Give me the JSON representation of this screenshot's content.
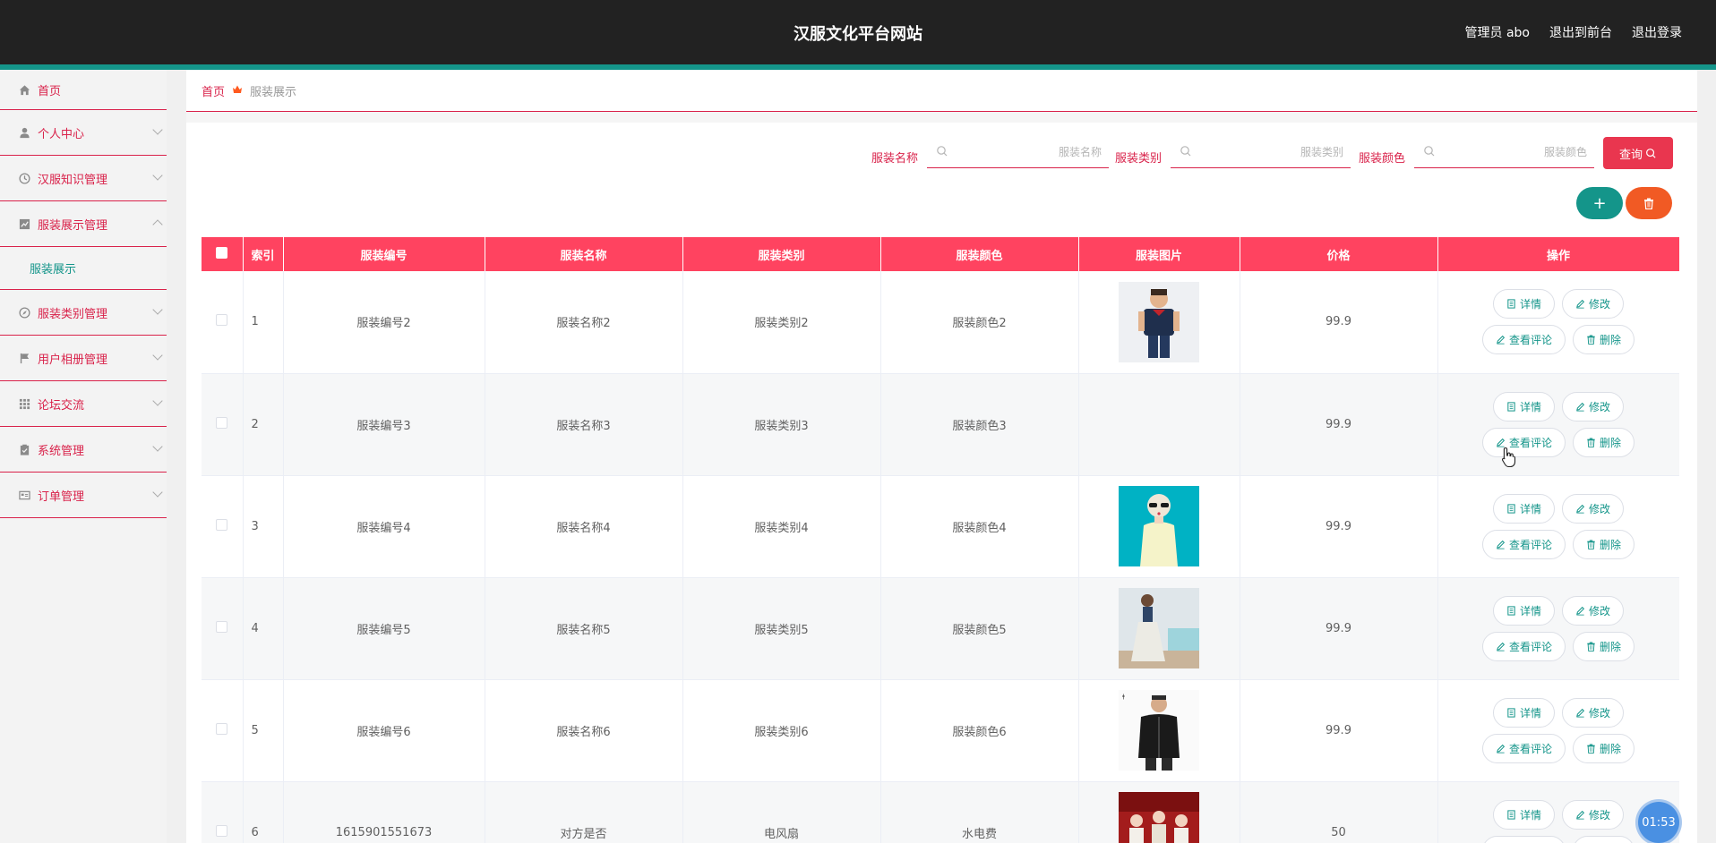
{
  "header": {
    "site_title": "汉服文化平台网站",
    "admin_label": "管理员 abo",
    "exit_front": "退出到前台",
    "logout": "退出登录"
  },
  "sidebar": {
    "items": [
      {
        "label": "首页",
        "icon": "home-icon"
      },
      {
        "label": "个人中心",
        "icon": "user-icon"
      },
      {
        "label": "汉服知识管理",
        "icon": "clock-icon"
      },
      {
        "label": "服装展示管理",
        "icon": "chart-icon",
        "expanded": true
      },
      {
        "label": "服装类别管理",
        "icon": "compass-icon"
      },
      {
        "label": "用户相册管理",
        "icon": "flag-icon"
      },
      {
        "label": "论坛交流",
        "icon": "grid-icon"
      },
      {
        "label": "系统管理",
        "icon": "clipboard-icon"
      },
      {
        "label": "订单管理",
        "icon": "card-icon"
      }
    ],
    "submenu_label": "服装展示"
  },
  "breadcrumb": {
    "home": "首页",
    "current": "服装展示"
  },
  "search": {
    "name_label": "服装名称",
    "name_placeholder": "服装名称",
    "category_label": "服装类别",
    "category_placeholder": "服装类别",
    "color_label": "服装颜色",
    "color_placeholder": "服装颜色",
    "button_label": "查询"
  },
  "table": {
    "headers": [
      "索引",
      "服装编号",
      "服装名称",
      "服装类别",
      "服装颜色",
      "服装图片",
      "价格",
      "操作"
    ],
    "rows": [
      {
        "index": "1",
        "code": "服装编号2",
        "name": "服装名称2",
        "category": "服装类别2",
        "color": "服装颜色2",
        "image": "boy-portrait",
        "price": "99.9"
      },
      {
        "index": "2",
        "code": "服装编号3",
        "name": "服装名称3",
        "category": "服装类别3",
        "color": "服装颜色3",
        "image": "",
        "price": "99.9"
      },
      {
        "index": "3",
        "code": "服装编号4",
        "name": "服装名称4",
        "category": "服装类别4",
        "color": "服装颜色4",
        "image": "woman-teal",
        "price": "99.9"
      },
      {
        "index": "4",
        "code": "服装编号5",
        "name": "服装名称5",
        "category": "服装类别5",
        "color": "服装颜色5",
        "image": "woman-room",
        "price": "99.9"
      },
      {
        "index": "5",
        "code": "服装编号6",
        "name": "服装名称6",
        "category": "服装类别6",
        "color": "服装颜色6",
        "image": "man-jacket",
        "price": "99.9"
      },
      {
        "index": "6",
        "code": "1615901551673",
        "name": "对方是否",
        "category": "电风扇",
        "color": "水电费",
        "image": "group-red",
        "price": "50"
      }
    ],
    "ops": {
      "detail": "详情",
      "edit": "修改",
      "comments": "查看评论",
      "delete": "删除"
    }
  },
  "timer": "01:53",
  "colors": {
    "accent": "#d9224a",
    "header_bg": "#222222",
    "teal": "#14958a",
    "table_head": "#ff4360",
    "orange": "#f15a24"
  }
}
